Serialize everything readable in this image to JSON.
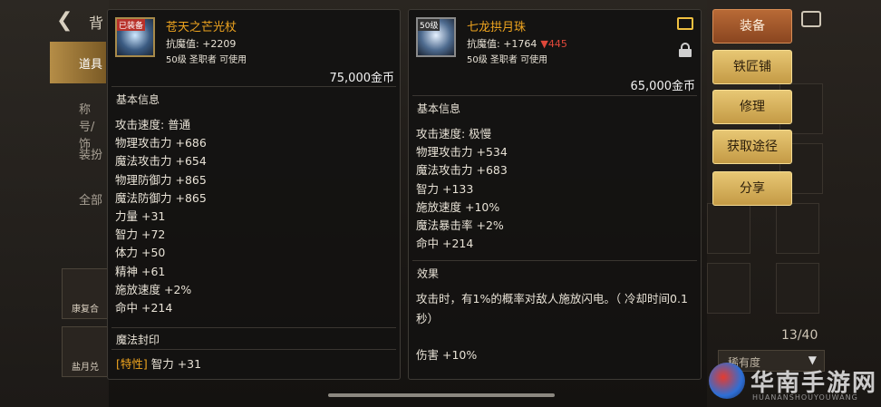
{
  "app": {
    "back_label": "背",
    "side_tabs": [
      "道具",
      "称号/饰",
      "装扮",
      "全部"
    ],
    "side_slots": [
      "康复合",
      "盐月兑"
    ],
    "inventory_count": "13/40",
    "sort_label": "稀有度",
    "watermark_text": "华南手游网",
    "watermark_sub": "HUANANSHOUYOUWANG"
  },
  "left_item": {
    "badge": "已装备",
    "name": "苍天之芒光杖",
    "stat_line": "抗魔值: +2209",
    "requirement": "50级 圣职者 可使用",
    "price": "75,000金币",
    "basic_title": "基本信息",
    "stats": [
      "攻击速度: 普通",
      "物理攻击力 +686",
      "魔法攻击力 +654",
      "物理防御力 +865",
      "魔法防御力 +865",
      "力量 +31",
      "智力 +72",
      "体力 +50",
      "精神 +61",
      "施放速度 +2%",
      "命中 +214"
    ],
    "seal_title": "魔法封印",
    "seal_tag": "[特性]",
    "seal_value": " 智力 +31"
  },
  "right_item": {
    "badge": "50级",
    "name": "七龙拱月珠",
    "stat_line": "抗魔值: +1764",
    "stat_diff": "▼445",
    "requirement": "50级 圣职者 可使用",
    "price": "65,000金币",
    "basic_title": "基本信息",
    "stats": [
      "攻击速度: 极慢",
      "物理攻击力 +534",
      "魔法攻击力 +683",
      "智力 +133",
      "施放速度 +10%",
      "魔法暴击率 +2%",
      "命中 +214"
    ],
    "effect_title": "效果",
    "effect_text": "攻击时，有1%的概率对敌人施放闪电。（ 冷却时间0.1秒）",
    "damage_text": "伤害 +10%"
  },
  "actions": {
    "equip": "装备",
    "smith": "铁匠铺",
    "repair": "修理",
    "source": "获取途径",
    "share": "分享"
  },
  "colors": {
    "item_name": "#f0a51f",
    "stat_down": "#e0483a",
    "button_gold": "#e7c774",
    "button_primary": "#b86a36"
  }
}
